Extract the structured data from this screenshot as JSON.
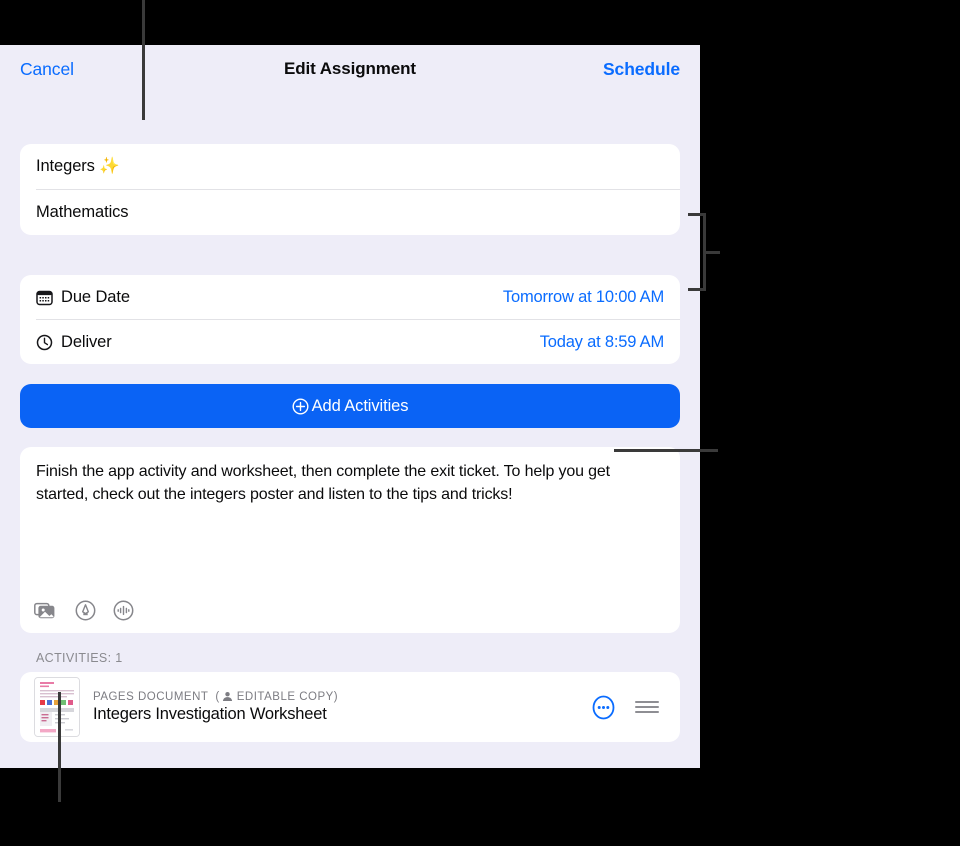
{
  "nav": {
    "cancel_label": "Cancel",
    "title": "Edit Assignment",
    "schedule_label": "Schedule"
  },
  "fields": {
    "assignment_title": "Integers ✨",
    "subject": "Mathematics"
  },
  "dates": [
    {
      "icon": "calendar-icon",
      "label": "Due Date",
      "value": "Tomorrow at 10:00 AM"
    },
    {
      "icon": "clock-icon",
      "label": "Deliver",
      "value": "Today at 8:59 AM"
    }
  ],
  "add_activities": {
    "label": "Add Activities",
    "icon": "plus-circle-icon"
  },
  "instructions": {
    "text": "Finish the app activity and worksheet, then complete the exit ticket. To help you get started, check out the integers poster and listen to the tips and tricks!",
    "tools": [
      {
        "name": "photo-library-icon"
      },
      {
        "name": "markup-pen-icon"
      },
      {
        "name": "audio-record-icon"
      }
    ]
  },
  "activities": {
    "section_label": "ACTIVITIES: 1",
    "items": [
      {
        "kind_prefix": "PAGES DOCUMENT",
        "kind_badge": "(",
        "kind_suffix": "EDITABLE COPY)",
        "title": "Integers Investigation Worksheet",
        "more_icon": "more-ellipsis-icon",
        "reorder_icon": "drag-handle-icon"
      }
    ]
  },
  "colors": {
    "accent_blue": "#0a6cff",
    "button_blue": "#0a63f5",
    "panel_background": "#eeedf8",
    "card_background": "#ffffff"
  }
}
